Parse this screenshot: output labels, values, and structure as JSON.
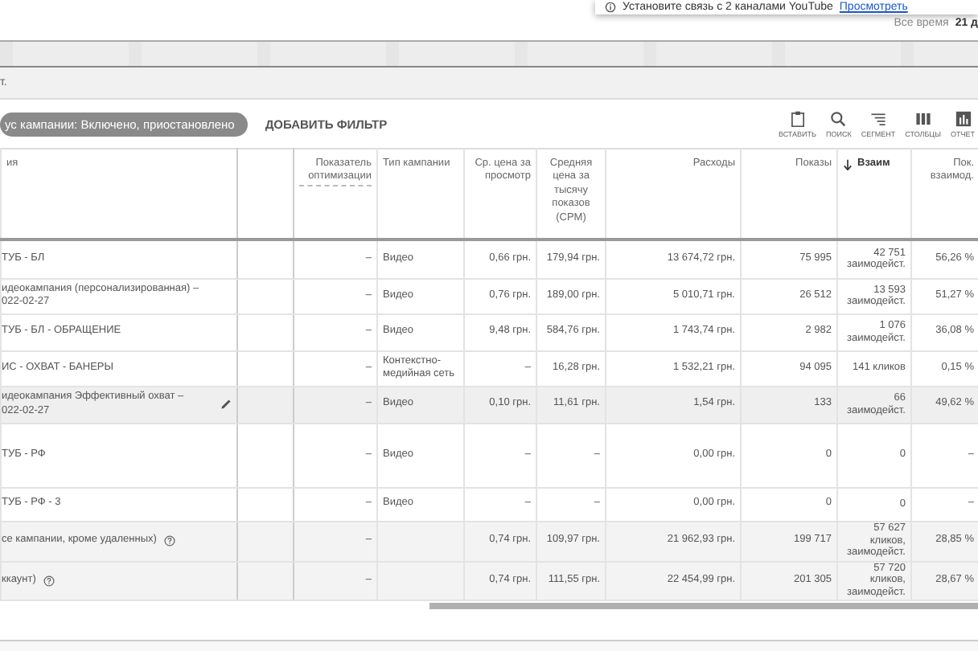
{
  "notification": {
    "text": "Установите связь с 2 каналами YouTube",
    "link": "Просмотреть"
  },
  "date_range": {
    "label": "Все время",
    "value": "21 д"
  },
  "breadcrumb": "т.",
  "toolbar": {
    "filter_chip": "ус кампании: Включено, приостановлено",
    "add_filter": "ДОБАВИТЬ ФИЛЬТР",
    "tools": [
      {
        "kind": "paste",
        "label": "ВСТАВИТЬ"
      },
      {
        "kind": "search",
        "label": "ПОИСК"
      },
      {
        "kind": "segment",
        "label": "СЕГМЕНТ"
      },
      {
        "kind": "columns",
        "label": "СТОЛБЦЫ"
      },
      {
        "kind": "reports",
        "label": "ОТЧЕТ"
      }
    ]
  },
  "table": {
    "columns": [
      {
        "label": "ия"
      },
      {
        "label": "Показатель оптимизации"
      },
      {
        "label": "Тип кампании"
      },
      {
        "label": "Ср. цена за просмотр"
      },
      {
        "label": "Средняя цена за тысячу показов (CPM)"
      },
      {
        "label": "Расходы"
      },
      {
        "label": "Показы"
      },
      {
        "label": "Взаим",
        "sorted": true
      },
      {
        "label": "Пок. взаимод."
      }
    ],
    "rows": [
      {
        "kind": "campaign",
        "highlighted": false,
        "cells": [
          "ТУБ - БЛ",
          "–",
          "Видео",
          "0,66 грн.",
          "179,94 грн.",
          "13 674,72 грн.",
          "75 995",
          "42 751 заимодейст.",
          "56,26 %"
        ]
      },
      {
        "kind": "campaign",
        "highlighted": false,
        "cells": [
          "идеокампания (персонализированная) –\n022-02-27",
          "–",
          "Видео",
          "0,76 грн.",
          "189,00 грн.",
          "5 010,71 грн.",
          "26 512",
          "13 593 заимодейст.",
          "51,27 %"
        ]
      },
      {
        "kind": "campaign",
        "highlighted": false,
        "cells": [
          "ТУБ - БЛ - ОБРАЩЕНИЕ",
          "–",
          "Видео",
          "9,48 грн.",
          "584,76 грн.",
          "1 743,74 грн.",
          "2 982",
          "1 076 заимодейст.",
          "36,08 %"
        ]
      },
      {
        "kind": "campaign",
        "highlighted": false,
        "cells": [
          "ИС - ОХВАТ - БАНЕРЫ",
          "–",
          "Контекстно-медийная сеть",
          "–",
          "16,28 грн.",
          "1 532,21 грн.",
          "94 095",
          "141 кликов",
          "0,15 %"
        ]
      },
      {
        "kind": "campaign",
        "highlighted": true,
        "cells": [
          "идеокампания Эффективный охват –\n022-02-27",
          "–",
          "Видео",
          "0,10 грн.",
          "11,61 грн.",
          "1,54 грн.",
          "133",
          "66 заимодейст.",
          "49,62 %"
        ]
      },
      {
        "kind": "campaign",
        "highlighted": false,
        "cells": [
          "ТУБ - РФ",
          "–",
          "Видео",
          "–",
          "–",
          "0,00 грн.",
          "0",
          "0",
          "–"
        ]
      },
      {
        "kind": "campaign",
        "highlighted": false,
        "cells": [
          "ТУБ - РФ - 3",
          "–",
          "Видео",
          "–",
          "–",
          "0,00 грн.",
          "0",
          "0",
          "–"
        ]
      },
      {
        "kind": "total",
        "highlighted": false,
        "cells": [
          "се кампании, кроме удаленных)",
          "–",
          null,
          "0,74 грн.",
          "109,97 грн.",
          "21 962,93 грн.",
          "199 717",
          "57 627 кликов, заимодейст.",
          "28,85 %"
        ]
      },
      {
        "kind": "total",
        "highlighted": false,
        "cells": [
          "ккаунт)",
          "–",
          null,
          "0,74 грн.",
          "111,55 грн.",
          "22 454,99 грн.",
          "201 305",
          "57 720 кликов, заимодейст.",
          "28,67 %"
        ]
      }
    ]
  }
}
